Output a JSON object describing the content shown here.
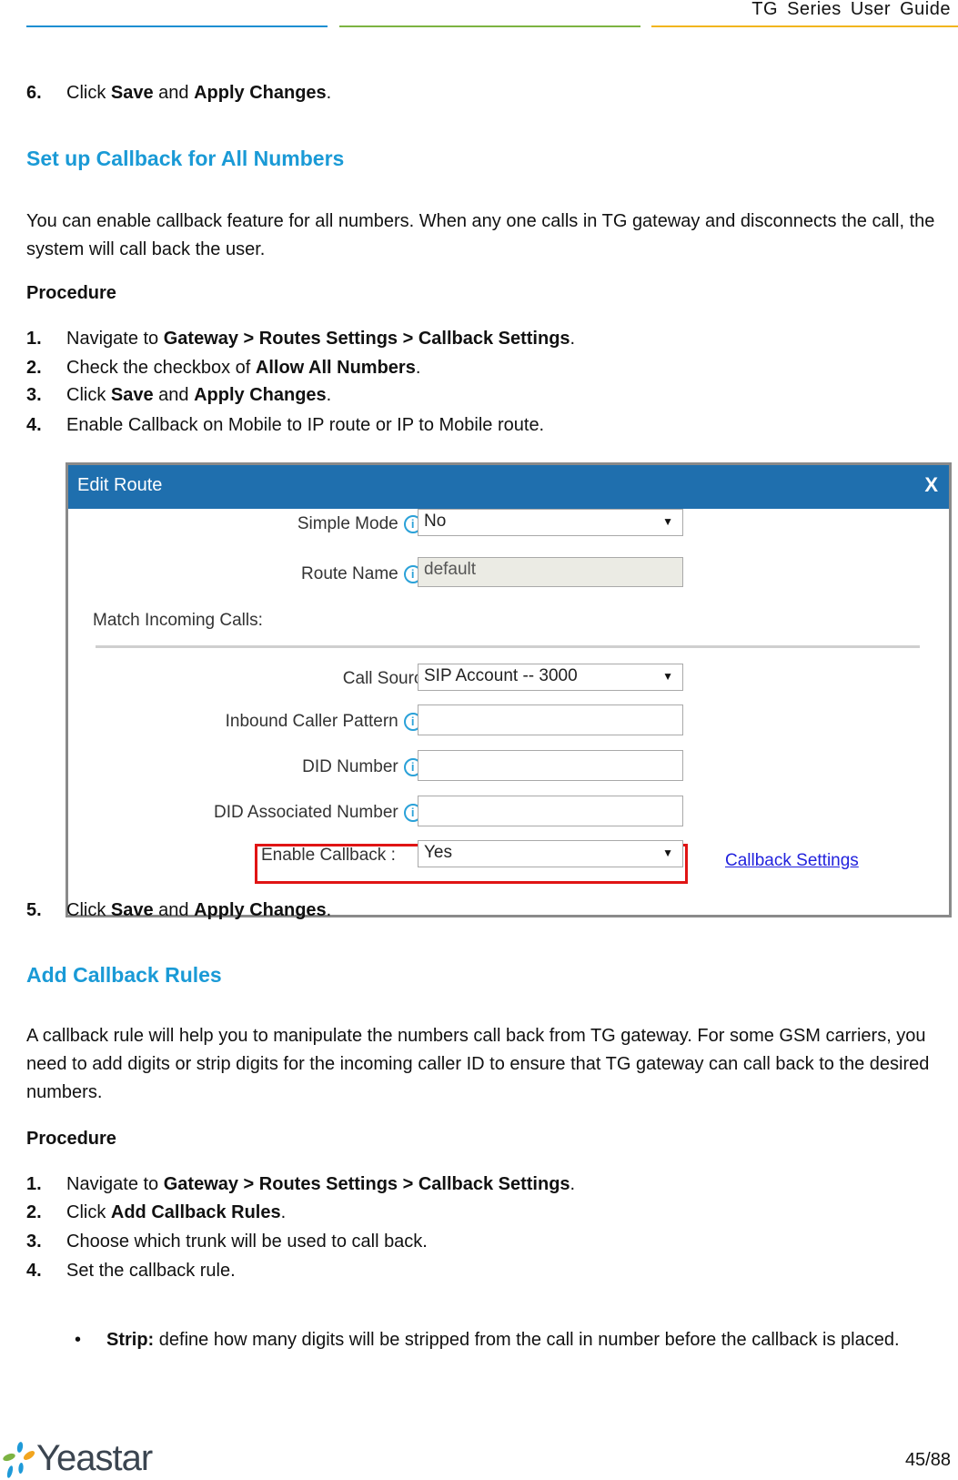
{
  "header": {
    "title": "TG Series User Guide",
    "rule_colors": [
      "#1d8fd2",
      "#7cb342",
      "#f2b51e"
    ]
  },
  "intro_step": {
    "num": "6.",
    "prefix": "Click ",
    "bold1": "Save",
    "mid": " and ",
    "bold2": "Apply Changes",
    "suffix": "."
  },
  "section1": {
    "title": "Set up Callback for All Numbers",
    "paragraph": "You can enable callback feature for all numbers. When any one calls in TG gateway and disconnects the call, the system will call back the user.",
    "procedure_label": "Procedure",
    "steps": [
      {
        "num": "1.",
        "prefix": "Navigate to ",
        "bold": "Gateway > Routes Settings > Callback Settings",
        "suffix": "."
      },
      {
        "num": "2.",
        "prefix": "Check the checkbox of ",
        "bold": "Allow All Numbers",
        "suffix": "."
      },
      {
        "num": "3.",
        "prefix": "Click ",
        "bold": "Save",
        "mid": " and ",
        "bold2": "Apply Changes",
        "suffix": "."
      },
      {
        "num": "4.",
        "prefix": "Enable Callback on Mobile to IP route or IP to Mobile route."
      },
      {
        "num": "5.",
        "prefix": "Click ",
        "bold": "Save",
        "mid": " and ",
        "bold2": "Apply Changes",
        "suffix": "."
      }
    ]
  },
  "modal": {
    "title": "Edit Route",
    "close_label": "X",
    "fields": {
      "simple_mode": {
        "label": "Simple Mode",
        "value": "No"
      },
      "route_name": {
        "label": "Route Name",
        "value": "default"
      },
      "match_incoming": {
        "label": "Match Incoming Calls:"
      },
      "call_source": {
        "label": "Call Source",
        "value": "SIP Account -- 3000"
      },
      "inbound_caller_pattern": {
        "label": "Inbound Caller Pattern",
        "value": ""
      },
      "did_number": {
        "label": "DID Number",
        "value": ""
      },
      "did_associated_number": {
        "label": "DID Associated Number",
        "value": ""
      },
      "enable_callback": {
        "label": "Enable Callback :",
        "value": "Yes"
      }
    },
    "callback_settings_link": "Callback Settings",
    "info_glyph": "i",
    "colon": ":",
    "caret": "▼",
    "highlight_color": "#e01414",
    "header_color": "#1f6fae"
  },
  "section2": {
    "title": "Add Callback Rules",
    "paragraph": "A callback rule will help you to manipulate the numbers call back from TG gateway. For some GSM carriers, you need to add digits or strip digits for the incoming caller ID to ensure that TG gateway can call back to the desired numbers.",
    "procedure_label": "Procedure",
    "steps": [
      {
        "num": "1.",
        "prefix": "Navigate to ",
        "bold": "Gateway > Routes Settings > Callback Settings",
        "suffix": "."
      },
      {
        "num": "2.",
        "prefix": "Click ",
        "bold": "Add Callback Rules",
        "suffix": "."
      },
      {
        "num": "3.",
        "prefix": "Choose which trunk will be used to call back."
      },
      {
        "num": "4.",
        "prefix": "Set the callback rule."
      }
    ],
    "bullets": [
      {
        "glyph": "•",
        "bold": "Strip:",
        "text": " define how many digits will be stripped from the call in number before the callback is placed."
      }
    ]
  },
  "footer": {
    "logo_text": "Yeastar",
    "page_number": "45/88"
  }
}
